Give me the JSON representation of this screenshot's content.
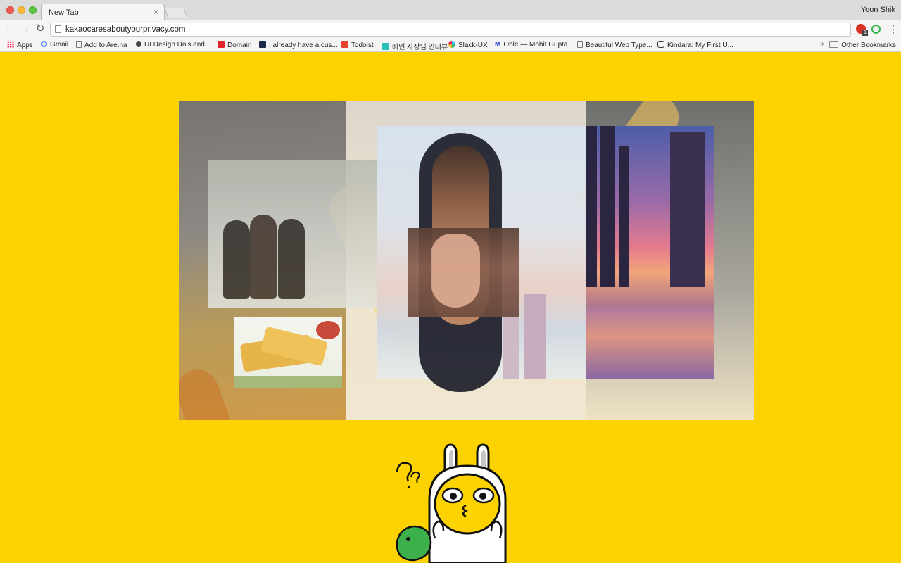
{
  "browser": {
    "tab_title": "New Tab",
    "tab_close": "×",
    "profile_name": "Yoon Shik",
    "url": "kakaocaresaboutyourprivacy.com",
    "menu_icon": "⋮",
    "back_icon": "←",
    "forward_icon": "→",
    "reload_icon": "↻",
    "extension_badge": "1"
  },
  "bookmarks": {
    "items": [
      {
        "label": "Apps",
        "icon": "apps-grid-icon"
      },
      {
        "label": "Gmail",
        "icon": "google-icon"
      },
      {
        "label": "Add to Are.na",
        "icon": "page-icon"
      },
      {
        "label": "UI Design Do's and...",
        "icon": "apple-icon"
      },
      {
        "label": "Domain",
        "icon": "domain-icon"
      },
      {
        "label": "I already have a cus...",
        "icon": "pf-icon"
      },
      {
        "label": "Todoist",
        "icon": "todoist-icon"
      },
      {
        "label": "배민 사장님 인터뷰",
        "icon": "baemin-icon"
      },
      {
        "label": "Slack-UX",
        "icon": "slack-icon"
      },
      {
        "label": "Oble — Mohit Gupta",
        "icon": "medium-icon"
      },
      {
        "label": "Beautiful Web Type...",
        "icon": "page-icon"
      },
      {
        "label": "Kindara: My First U...",
        "icon": "kindara-icon"
      }
    ],
    "overflow": "»",
    "other_label": "Other Bookmarks"
  },
  "page": {
    "background_color": "#fcd200",
    "collage_images": [
      "winter-street-photo",
      "grilled-cheese-photo",
      "city-skyline-photo",
      "shoe-photo",
      "portrait-photo",
      "fries-background-photo"
    ],
    "character_question_marks": "?"
  }
}
